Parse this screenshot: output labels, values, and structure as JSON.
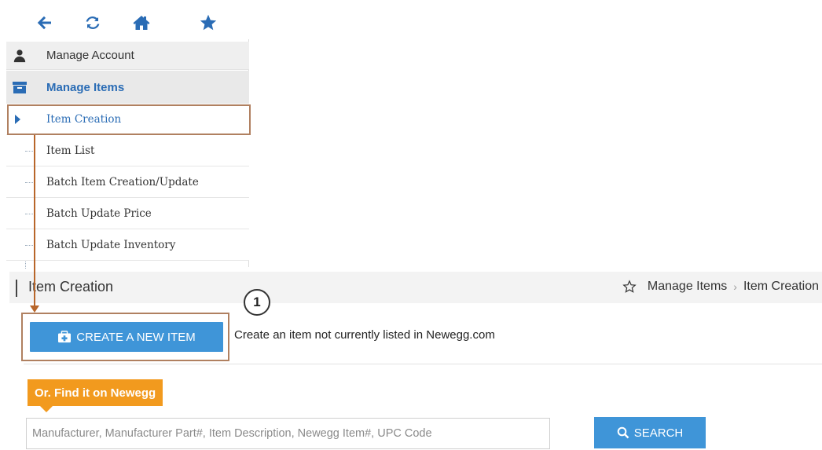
{
  "toolbar": {
    "icons": [
      "back-arrow-icon",
      "refresh-icon",
      "home-icon",
      "star-icon"
    ]
  },
  "sidebar": {
    "account_label": "Manage Account",
    "items_label": "Manage Items",
    "sub_items": [
      {
        "label": "Item Creation",
        "active": true
      },
      {
        "label": "Item List"
      },
      {
        "label": "Batch Item Creation/Update"
      },
      {
        "label": "Batch Update Price"
      },
      {
        "label": "Batch Update Inventory"
      }
    ]
  },
  "header": {
    "title": "Item Creation",
    "breadcrumb": [
      "Manage Items",
      "Item Creation"
    ],
    "breadcrumb_separator": "›"
  },
  "annotation": {
    "step": "1"
  },
  "create": {
    "button_label": "CREATE A NEW ITEM",
    "description": "Create an item not currently listed in Newegg.com"
  },
  "find": {
    "tag_label": "Or. Find it on Newegg",
    "placeholder": "Manufacturer, Manufacturer Part#, Item Description, Newegg Item#, UPC Code",
    "search_label": "SEARCH"
  },
  "colors": {
    "primary_blue": "#3f95d8",
    "link_blue": "#2a6cb5",
    "orange_tag": "#f29a1e",
    "annotation_brown": "#b08060"
  }
}
